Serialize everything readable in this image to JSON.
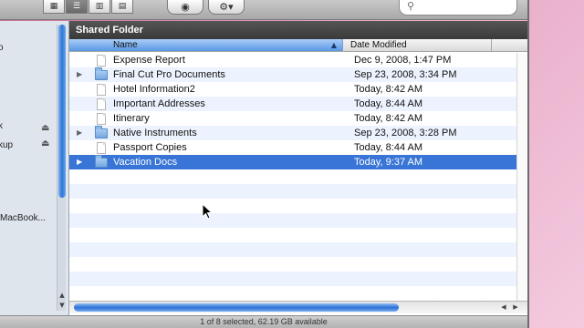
{
  "toolbar": {
    "view_icons": [
      "icon-view-icon",
      "list-view-icon",
      "column-view-icon",
      "cover-flow-icon"
    ],
    "active_view": "list-view-icon",
    "quicklook_icon": "eye-icon",
    "action_icon": "gear-icon",
    "search_icon": "magnifier-icon"
  },
  "sidebar": {
    "items": [
      {
        "label": "o"
      },
      {
        "label": "k"
      },
      {
        "label": "kup"
      },
      {
        "label": "MacBook..."
      }
    ],
    "eject_icon": "eject-icon"
  },
  "pane": {
    "title": "Shared Folder",
    "columns": {
      "name": "Name",
      "date": "Date Modified"
    }
  },
  "rows": [
    {
      "name": "Expense Report",
      "date": "Dec 9, 2008, 1:47 PM",
      "kind": "document"
    },
    {
      "name": "Final Cut Pro Documents",
      "date": "Sep 23, 2008, 3:34 PM",
      "kind": "folder"
    },
    {
      "name": "Hotel Information2",
      "date": "Today, 8:42 AM",
      "kind": "document"
    },
    {
      "name": "Important Addresses",
      "date": "Today, 8:44 AM",
      "kind": "document"
    },
    {
      "name": "Itinerary",
      "date": "Today, 8:42 AM",
      "kind": "document"
    },
    {
      "name": "Native Instruments",
      "date": "Sep 23, 2008, 3:28 PM",
      "kind": "folder"
    },
    {
      "name": "Passport Copies",
      "date": "Today, 8:44 AM",
      "kind": "document"
    },
    {
      "name": "Vacation Docs",
      "date": "Today, 9:37 AM",
      "kind": "folder",
      "selected": true
    }
  ],
  "status": {
    "text": "1 of 8 selected, 62.19 GB available"
  },
  "colors": {
    "selection": "#3875d7",
    "stripe": "#edf3fe",
    "title_bar": "#444444"
  }
}
